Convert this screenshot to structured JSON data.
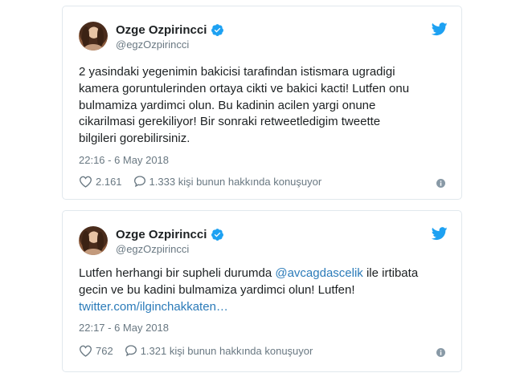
{
  "tweets": [
    {
      "author_name": "Ozge Ozpirincci",
      "handle": "@egzOzpirincci",
      "text": "2 yasindaki yegenimin bakicisi tarafindan istismara ugradigi\nkamera goruntulerinden ortaya cikti ve bakici kacti! Lutfen onu\nbulmamiza yardimci olun. Bu kadinin acilen yargi onune\ncikarilmasi gerekiliyor!  Bir sonraki retweetledigim tweette\nbilgileri gorebilirsiniz.",
      "timestamp": "22:16 - 6 May 2018",
      "likes": "2.161",
      "replies_text": "1.333 kişi bunun hakkında konuşuyor"
    },
    {
      "author_name": "Ozge Ozpirincci",
      "handle": "@egzOzpirincci",
      "text_part1": "Lutfen herhangi bir supheli durumda ",
      "mention": "@avcagdascelik",
      "text_part2": " ile irtibata\ngecin ve bu kadini bulmamiza yardimci olun! Lutfen!\n",
      "link": "twitter.com/ilginchakkaten…",
      "timestamp": "22:17 - 6 May 2018",
      "likes": "762",
      "replies_text": "1.321 kişi bunun hakkında konuşuyor"
    }
  ],
  "icons": {
    "verified": "verified-badge-icon",
    "bird": "twitter-bird-icon",
    "heart": "heart-icon",
    "reply": "speech-bubble-icon",
    "info": "info-icon"
  },
  "colors": {
    "verified_blue": "#1da1f2",
    "link_blue": "#2b7bb9",
    "muted_gray": "#697882",
    "border": "#e1e8ed"
  }
}
